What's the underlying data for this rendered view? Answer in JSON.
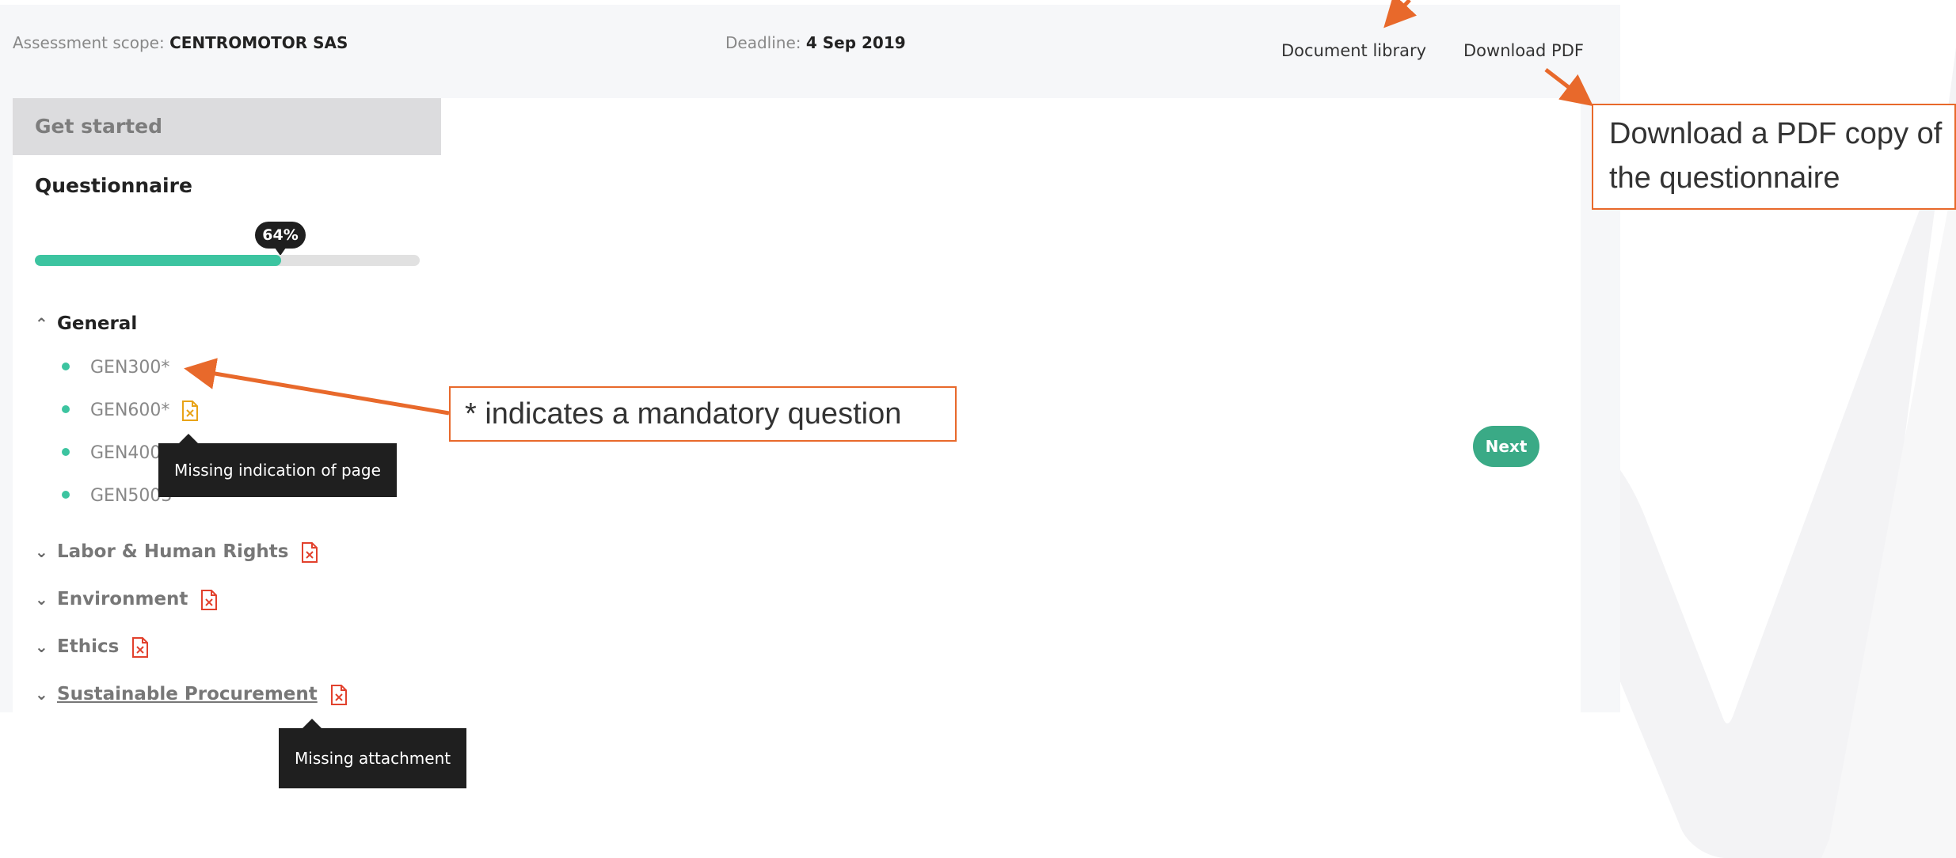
{
  "header": {
    "scope_label": "Assessment scope:",
    "scope_value": "CENTROMOTOR SAS",
    "deadline_label": "Deadline:",
    "deadline_value": "4 Sep 2019",
    "document_library": "Document library",
    "download_pdf": "Download PDF"
  },
  "sidebar": {
    "get_started": "Get started",
    "questionnaire": "Questionnaire",
    "progress_label": "64%",
    "progress": 0.64,
    "general": {
      "label": "General",
      "items": [
        {
          "label": "GEN300*"
        },
        {
          "label": "GEN600*"
        },
        {
          "label": "GEN400"
        },
        {
          "label": "GEN5003*"
        }
      ]
    },
    "sections": [
      {
        "label": "Labor & Human Rights"
      },
      {
        "label": "Environment"
      },
      {
        "label": "Ethics"
      },
      {
        "label": "Sustainable Procurement"
      }
    ]
  },
  "main": {
    "next": "Next"
  },
  "tooltips": {
    "missing_page": "Missing indication of page",
    "missing_attachment": "Missing attachment"
  },
  "callouts": {
    "mandatory": "* indicates a mandatory question",
    "pdf_line1": "Download a PDF copy of",
    "pdf_line2": "the questionnaire"
  },
  "colors": {
    "accent": "#3cc4a0",
    "next_button": "#3aaa86",
    "annotation": "#e8692b",
    "warning_icon": "#e8a317",
    "error_icon": "#e2412d"
  },
  "icons": {
    "warning_file": "file-warning-icon",
    "error_file": "file-error-icon",
    "expand": "chevron-up-icon",
    "collapse": "chevron-down-icon"
  }
}
